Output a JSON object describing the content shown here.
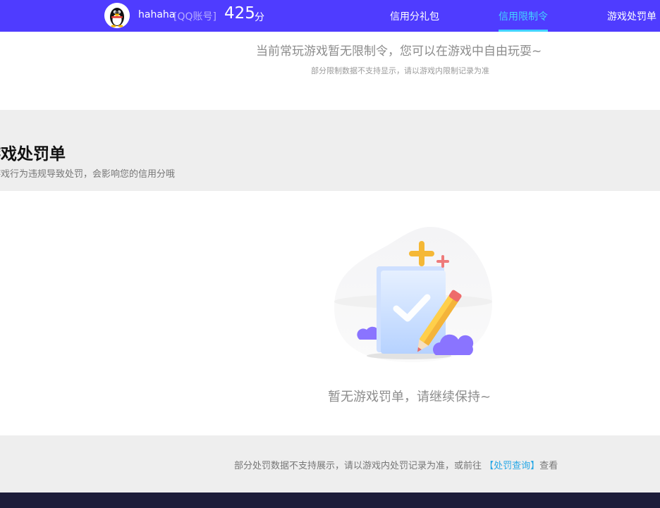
{
  "user": {
    "name": "hahaha",
    "account_type": "[QQ账号]",
    "score": "425",
    "score_unit": "分"
  },
  "nav": {
    "tabs": [
      {
        "label": "信用分礼包",
        "active": false
      },
      {
        "label": "信用限制令",
        "active": true
      },
      {
        "label": "游戏处罚单",
        "active": false
      }
    ]
  },
  "restriction": {
    "message": "当前常玩游戏暂无限制令，您可以在游戏中自由玩耍~",
    "sub_note": "部分限制数据不支持显示，请以游戏内限制记录为准"
  },
  "penalty_section": {
    "title": "游戏处罚单",
    "description": "游戏行为违规导致处罚，会影响您的信用分哦",
    "empty_message": "暂无游戏罚单，请继续保持~"
  },
  "footer_note": {
    "prefix": "部分处罚数据不支持展示，请以游戏内处罚记录为准，或前往",
    "link_label": "【处罚查询】",
    "suffix": "查看"
  },
  "colors": {
    "nav_bg": "#4f3cff",
    "nav_active": "#43d4ff",
    "link": "#28a8e6",
    "footer_bg": "#1d1d3a"
  }
}
